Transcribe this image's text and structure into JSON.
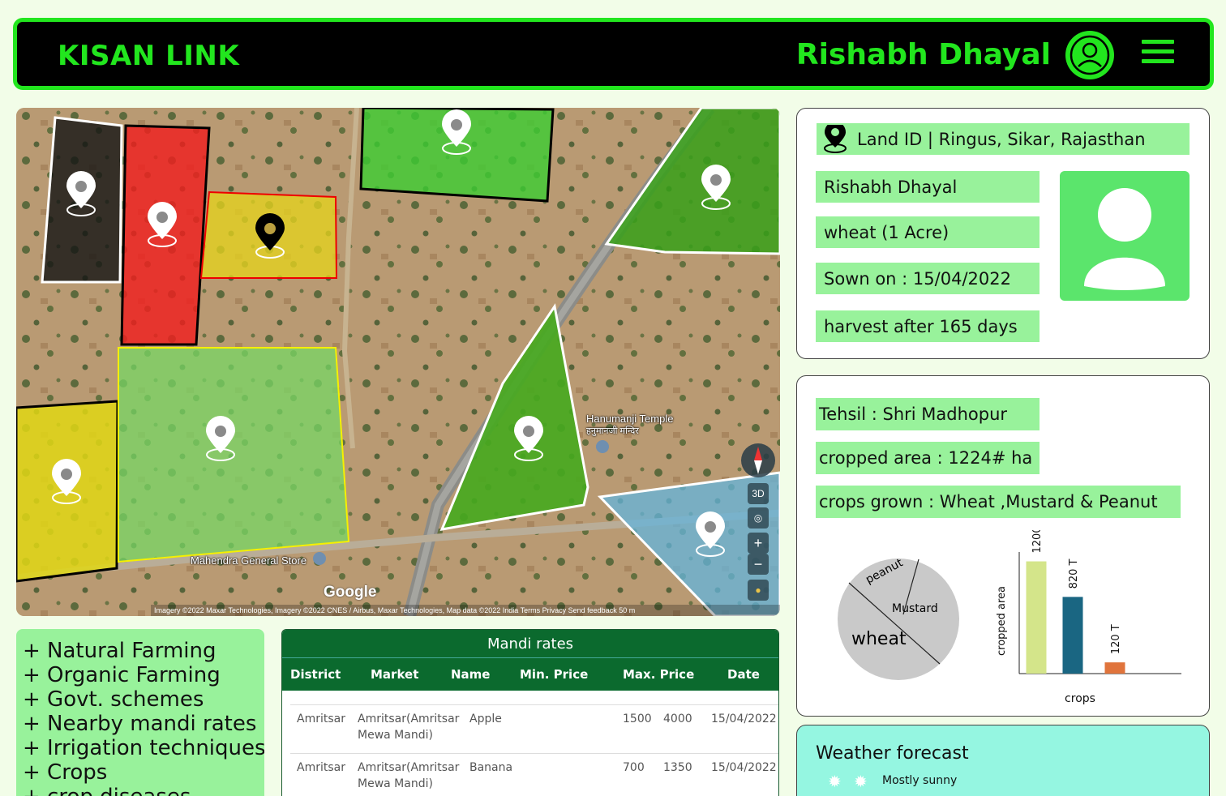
{
  "header": {
    "brand": "KISAN LINK",
    "user_name": "Rishabh Dhayal",
    "avatar_icon": "user-circle-icon",
    "menu_icon": "hamburger-menu-icon"
  },
  "map": {
    "labels": {
      "temple": "Hanumanji Temple",
      "temple_hindi": "हनुमानजी मन्दिर",
      "store": "Mahendra General Store"
    },
    "google": "Google",
    "controls": {
      "three_d": "3D",
      "zoom_in": "+",
      "zoom_out": "−"
    },
    "attribution": "Imagery ©2022 Maxar Technologies, Imagery ©2022 CNES / Airbus, Maxar Technologies, Map data ©2022     India     Terms     Privacy     Send feedback     50 m"
  },
  "land_info": {
    "location": "Land ID | Ringus, Sikar, Rajasthan",
    "owner": "Rishabh Dhayal",
    "crop": "wheat  (1 Acre)",
    "sown": "Sown on : 15/04/2022",
    "harvest": "harvest after  165 days"
  },
  "stats": {
    "tehsil": "Tehsil : Shri Madhopur",
    "cropped_area": "cropped area : 1224# ha",
    "crops_grown": "crops grown : Wheat ,Mustard & Peanut"
  },
  "pie_labels": {
    "wheat": "wheat",
    "mustard": "Mustard",
    "peanut": "peanut"
  },
  "chart_data": {
    "type": "bar",
    "categories": [
      "",
      "",
      ""
    ],
    "values": [
      1200,
      820,
      120
    ],
    "data_labels": [
      "1200 T",
      "820 T",
      "120 T"
    ],
    "colors": [
      "#d4e58a",
      "#1a6682",
      "#e0743c"
    ],
    "xlabel": "crops",
    "ylabel": "cropped area",
    "ylim": [
      0,
      1300
    ]
  },
  "links": [
    "+ Natural Farming",
    "+ Organic Farming",
    "+ Govt. schemes",
    "+ Nearby mandi rates",
    "+ Irrigation techniques",
    "+ Crops",
    "+ crop diseases"
  ],
  "mandi": {
    "title": "Mandi rates",
    "columns": [
      "District",
      "Market",
      "Name",
      "Min. Price",
      "Max. Price",
      "Date"
    ],
    "rows": [
      {
        "district": "Amritsar",
        "market1": "Amritsar(Amritsar",
        "market2": "Mewa Mandi)",
        "name": "Apple",
        "min": "1500",
        "max": "4000",
        "date": "15/04/2022"
      },
      {
        "district": "Amritsar",
        "market1": "Amritsar(Amritsar",
        "market2": "Mewa Mandi)",
        "name": "Banana",
        "min": "700",
        "max": "1350",
        "date": "15/04/2022"
      }
    ]
  },
  "weather": {
    "title": "Weather forecast",
    "status": "Mostly sunny",
    "icon": "sun-icon"
  }
}
